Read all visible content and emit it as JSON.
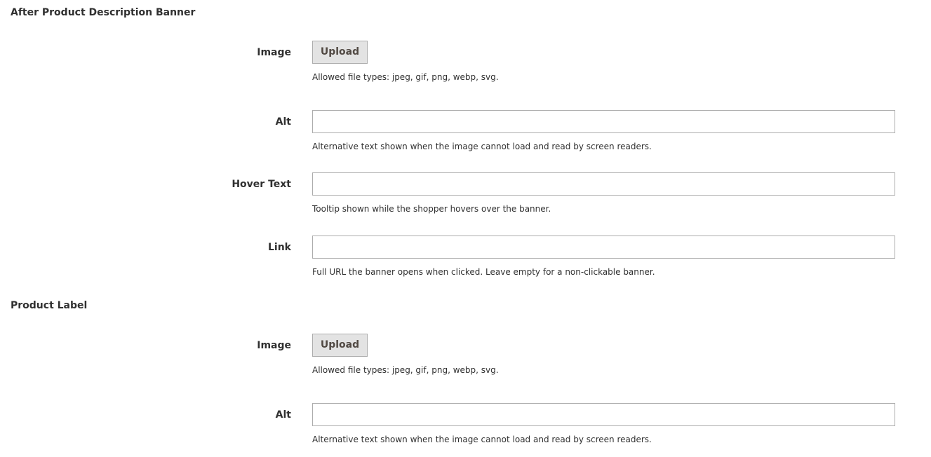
{
  "sections": [
    {
      "title": "After Product Description Banner",
      "image": {
        "label": "Image",
        "button_label": "Upload",
        "note": "Allowed file types: jpeg, gif, png, webp, svg."
      },
      "alt": {
        "label": "Alt",
        "value": "",
        "note": "Alternative text shown when the image cannot load and read by screen readers."
      },
      "hover_text": {
        "label": "Hover Text",
        "value": "",
        "note": "Tooltip shown while the shopper hovers over the banner."
      },
      "link": {
        "label": "Link",
        "value": "",
        "note": "Full URL the banner opens when clicked. Leave empty for a non-clickable banner."
      }
    },
    {
      "title": "Product Label",
      "image": {
        "label": "Image",
        "button_label": "Upload",
        "note": "Allowed file types: jpeg, gif, png, webp, svg."
      },
      "alt": {
        "label": "Alt",
        "value": "",
        "note": "Alternative text shown when the image cannot load and read by screen readers."
      }
    }
  ]
}
